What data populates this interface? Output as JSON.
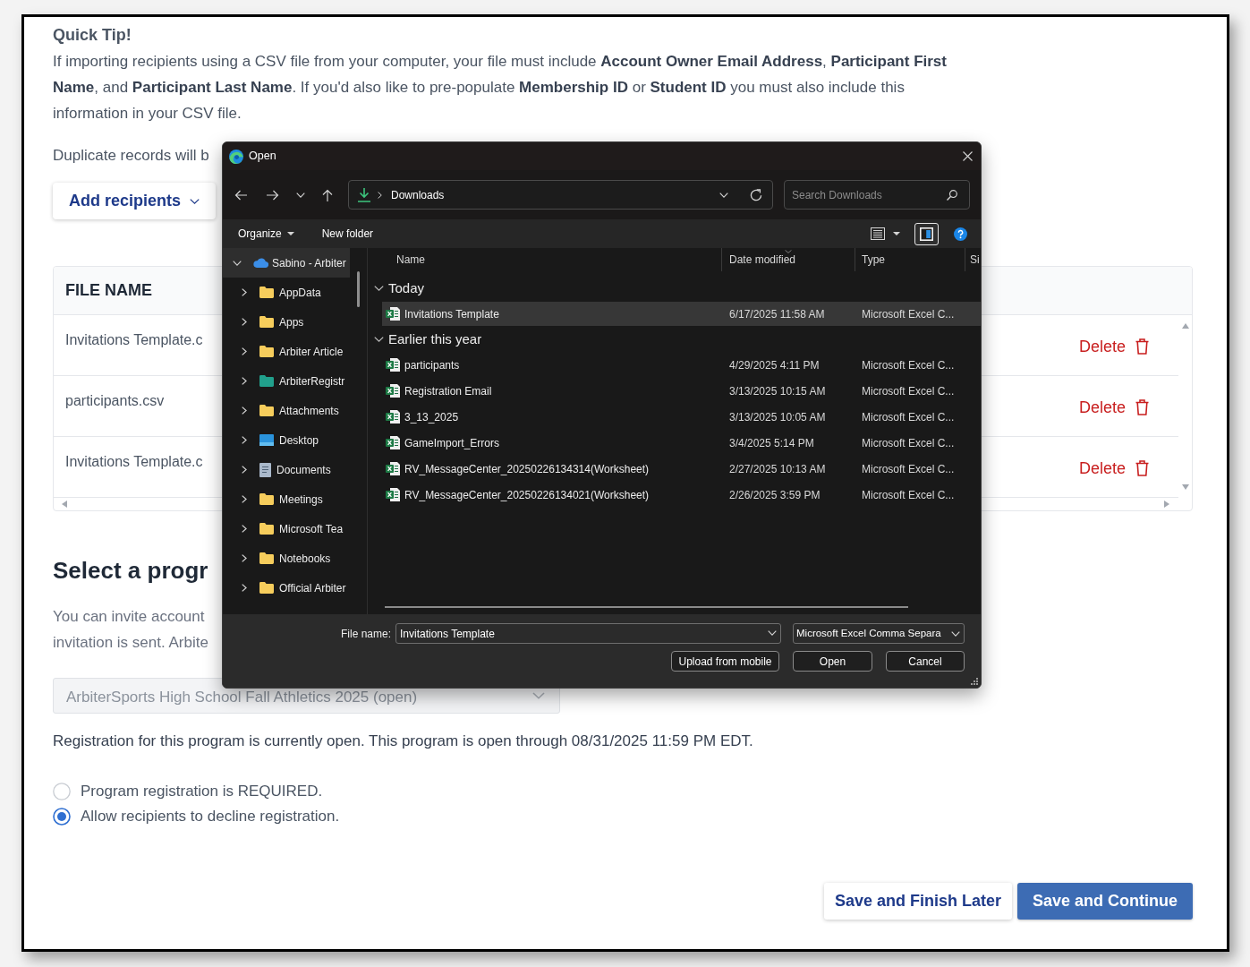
{
  "page": {
    "tip": {
      "title": "Quick Tip!",
      "text": "If importing recipients using a CSV file from your computer, your file must include **Account Owner Email Address**, **Participant First Name**, and **Participant Last Name**. If you'd also like to pre-populate **Membership ID** or **Student ID** you must also include this information in your CSV file."
    },
    "duplicate_note": "Duplicate records will b",
    "add_button": {
      "label": "Add recipients"
    },
    "files_table": {
      "columns": [
        "FILE NAME"
      ],
      "rows": [
        {
          "file_name": "Invitations Template.c",
          "action": "Delete"
        },
        {
          "file_name": "participants.csv",
          "action": "Delete"
        },
        {
          "file_name": "Invitations Template.c",
          "action": "Delete"
        }
      ]
    },
    "program": {
      "heading": "Select a progr",
      "description_lines": [
        "You can invite account",
        "invitation is sent. Arbite"
      ],
      "select": {
        "value": "ArbiterSports High School Fall Athletics 2025 (open)",
        "disabled": true
      },
      "status": "Registration for this program is currently open. This program is open through 08/31/2025 11:59 PM EDT.",
      "options": [
        {
          "label": "Program registration is REQUIRED.",
          "selected": false
        },
        {
          "label": "Allow recipients to decline registration.",
          "selected": true
        }
      ]
    },
    "buttons": [
      {
        "label": "Save and Finish Later",
        "kind": "secondary"
      },
      {
        "label": "Save and Continue",
        "kind": "primary"
      }
    ]
  },
  "dialog": {
    "title": "Open",
    "address": {
      "path": "Downloads"
    },
    "search": {
      "placeholder": "Search Downloads"
    },
    "toolbar": {
      "organize": "Organize",
      "new_folder": "New folder",
      "preview_pane_selected": true
    },
    "nav_tree": [
      {
        "label": "Sabino - Arbiter",
        "kind": "cloud",
        "expanded": true,
        "selected": true,
        "children": [
          {
            "label": "AppData",
            "kind": "folder",
            "color": "#f6cd5c",
            "expanded": false,
            "selected": false
          },
          {
            "label": "Apps",
            "kind": "folder",
            "color": "#f6cd5c",
            "expanded": false,
            "selected": false
          },
          {
            "label": "Arbiter Article",
            "kind": "folder",
            "color": "#f6cd5c",
            "expanded": false,
            "selected": false
          },
          {
            "label": "ArbiterRegistr",
            "kind": "folder",
            "color": "#21a08c",
            "expanded": false,
            "selected": false
          },
          {
            "label": "Attachments",
            "kind": "folder",
            "color": "#f6cd5c",
            "expanded": false,
            "selected": false
          },
          {
            "label": "Desktop",
            "kind": "desktop",
            "expanded": false,
            "selected": false
          },
          {
            "label": "Documents",
            "kind": "documents",
            "expanded": false,
            "selected": false
          },
          {
            "label": "Meetings",
            "kind": "folder",
            "color": "#f6cd5c",
            "expanded": false,
            "selected": false
          },
          {
            "label": "Microsoft Tea",
            "kind": "folder",
            "color": "#f6cd5c",
            "expanded": false,
            "selected": false
          },
          {
            "label": "Notebooks",
            "kind": "folder",
            "color": "#f6cd5c",
            "expanded": false,
            "selected": false
          },
          {
            "label": "Official Arbiter",
            "kind": "folder",
            "color": "#f6cd5c",
            "expanded": false,
            "selected": false
          }
        ]
      }
    ],
    "columns": [
      {
        "label": "Name",
        "sorted": false
      },
      {
        "label": "Date modified",
        "sorted": true
      },
      {
        "label": "Type",
        "sorted": false
      },
      {
        "label": "Si",
        "sorted": false
      }
    ],
    "groups": [
      {
        "label": "Today",
        "expanded": true,
        "files": [
          {
            "name": "Invitations Template",
            "date": "6/17/2025 11:58 AM",
            "type": "Microsoft Excel C...",
            "selected": true
          }
        ]
      },
      {
        "label": "Earlier this year",
        "expanded": true,
        "files": [
          {
            "name": "participants",
            "date": "4/29/2025 4:11 PM",
            "type": "Microsoft Excel C...",
            "selected": false
          },
          {
            "name": "Registration Email",
            "date": "3/13/2025 10:15 AM",
            "type": "Microsoft Excel C...",
            "selected": false
          },
          {
            "name": "3_13_2025",
            "date": "3/13/2025 10:05 AM",
            "type": "Microsoft Excel C...",
            "selected": false
          },
          {
            "name": "GameImport_Errors",
            "date": "3/4/2025 5:14 PM",
            "type": "Microsoft Excel C...",
            "selected": false
          },
          {
            "name": "RV_MessageCenter_20250226134314(Worksheet)",
            "date": "2/27/2025 10:13 AM",
            "type": "Microsoft Excel C...",
            "selected": false
          },
          {
            "name": "RV_MessageCenter_20250226134021(Worksheet)",
            "date": "2/26/2025 3:59 PM",
            "type": "Microsoft Excel C...",
            "selected": false
          }
        ]
      }
    ],
    "file_name": {
      "label": "File name:",
      "value": "Invitations Template"
    },
    "file_type": {
      "value": "Microsoft Excel Comma Separa"
    },
    "buttons": [
      {
        "label": "Upload from mobile"
      },
      {
        "label": "Open"
      },
      {
        "label": "Cancel"
      }
    ]
  }
}
